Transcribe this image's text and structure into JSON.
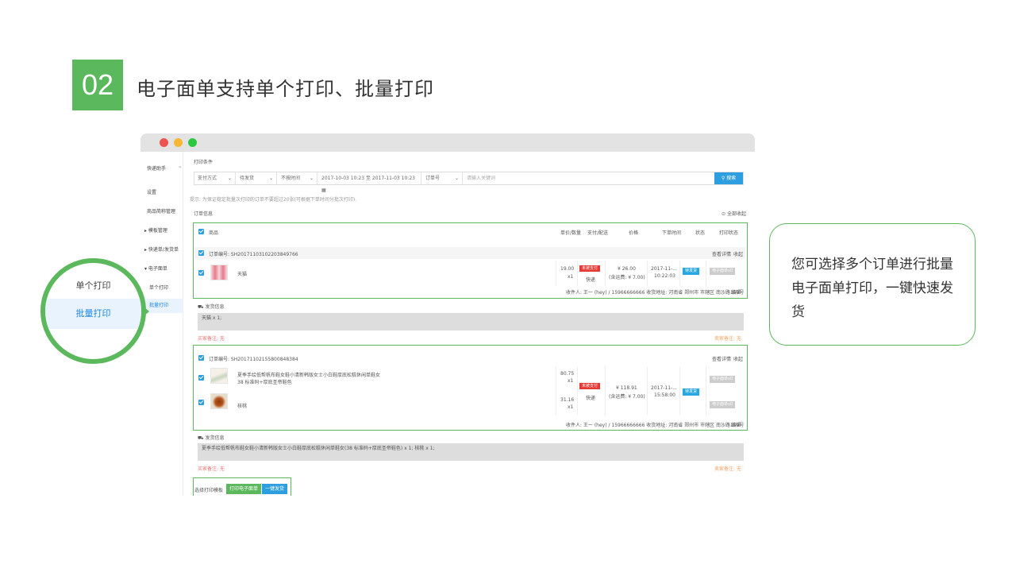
{
  "slide": {
    "number": "02",
    "title": "电子面单支持单个打印、批量打印"
  },
  "sidebar": {
    "app_title": "快递助手",
    "collapse_icon": "«",
    "items": [
      "设置",
      "商品简称管理",
      "模板管理",
      "快递单/发货单",
      "电子面单",
      "单个打印",
      "批量打印"
    ]
  },
  "filters": {
    "section_label": "打印条件",
    "pay_method": "支付方式",
    "ship_status": "待发货",
    "time_type": "不按时间",
    "date_range": "2017-10-03 10:23 至 2017-11-03 10:23",
    "order_field": "订单号",
    "search_placeholder": "请输入关键词",
    "search_button": "搜索",
    "tip": "提示: 为保证稳定批量次打印的订单不要超过20张(可根据下单时间分批次打印)."
  },
  "orders_header": {
    "label": "订单信息",
    "collapse_all": "全部收起",
    "col_product": "商品",
    "col_price_qty": "单价/数量",
    "col_pay_ship": "支付/配送",
    "col_amount": "价格",
    "col_time": "下单时间",
    "col_status": "状态",
    "col_print_status": "打印状态"
  },
  "orders": [
    {
      "order_no": "订单编号: SH20171103102203849766",
      "view_detail": "查看详情",
      "collapse": "收起",
      "items": [
        {
          "name": "天猫",
          "price": "19.00",
          "qty": "x1"
        }
      ],
      "pay_tag": "未被支付",
      "ship_method": "快递",
      "amount": "¥ 26.00",
      "amount_note": "(含运费: ¥ 7.00)",
      "time_date": "2017-11-...",
      "time_clock": "10:22:03",
      "status": "待发货",
      "print_status": "电子面单x0",
      "receiver": "收件人: 王一 (hey) / 15966666666 收货地址: 河南省 郑州市 市辖区 南沙路159号",
      "edit": "编辑",
      "shipping_label": "发货信息",
      "shipping_text": "天猫 x 1;",
      "buyer_note": "买家备注: 无",
      "seller_note": "卖家备注: 无"
    },
    {
      "order_no": "订单编号: SH20171102155800848384",
      "view_detail": "查看详情",
      "collapse": "收起",
      "items": [
        {
          "name": "夏季手绘低帮帆布鞋女鞋小清新韩版女士小白鞋厚底松糕休闲单鞋女",
          "sku": "38 标准码+厚底圣帝鞋色",
          "price": "80.75",
          "qty": "x1"
        },
        {
          "name": "核桃",
          "price": "31.16",
          "qty": "x1"
        }
      ],
      "pay_tag": "未被支付",
      "ship_method": "快递",
      "amount": "¥ 118.91",
      "amount_note": "(含运费: ¥ 7.00)",
      "time_date": "2017-11-...",
      "time_clock": "15:58:00",
      "status": "待发货",
      "print_status": "电子面单x0",
      "receiver": "收件人: 王一 (hey) / 15966666666 收货地址: 河南省 郑州市 市辖区 南沙路159号",
      "edit": "编辑",
      "shipping_label": "发货信息",
      "shipping_text": "夏季手绘低帮帆布鞋女鞋小清新韩版女士小白鞋厚底松糕休闲单鞋女(38 标准码+厚底圣帝鞋色) x 1; 核桃 x 1;",
      "buyer_note": "买家备注: 无",
      "seller_note": "卖家备注: 无"
    }
  ],
  "bottom_bar": {
    "template_label": "选择打印模板",
    "print_button": "打印电子面单",
    "ship_button": "一键发货"
  },
  "zoom": {
    "item_single": "单个打印",
    "item_batch": "批量打印"
  },
  "callout": {
    "text": "您可选择多个订单进行批量电子面单打印，一键快速发货"
  },
  "colors": {
    "accent_green": "#5cb85c",
    "accent_blue": "#2d9ee0",
    "tag_red": "#e53935"
  }
}
